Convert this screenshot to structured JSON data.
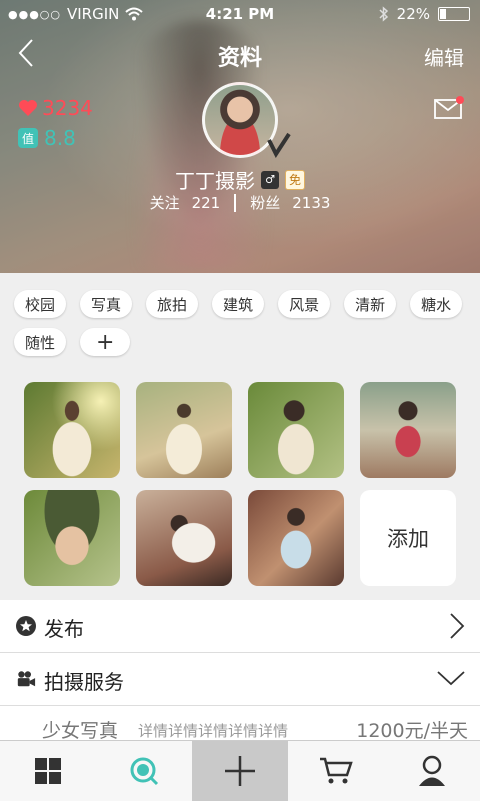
{
  "status_bar": {
    "carrier": "VIRGIN",
    "time": "4:21 PM",
    "battery": "22%",
    "battery_level": 0.22
  },
  "header": {
    "title": "资料",
    "edit_label": "编辑"
  },
  "profile": {
    "likes": "3234",
    "score_badge": "值",
    "score": "8.8",
    "name": "丁丁摄影",
    "free_badge": "免",
    "following_label": "关注",
    "following": "221",
    "fans_label": "粉丝",
    "fans": "2133"
  },
  "tags": [
    "校园",
    "写真",
    "旅拍",
    "建筑",
    "风景",
    "清新",
    "糖水",
    "随性"
  ],
  "add_tag_label": "+",
  "photos_add_label": "添加",
  "sections": {
    "publish": "发布",
    "service": "拍摄服务"
  },
  "service_item": {
    "name": "少女写真",
    "desc": "详情详情详情详情详情",
    "price": "1200元/半天"
  },
  "tabbar": {
    "active_index": 2
  },
  "colors": {
    "like": "#ff4b57",
    "accent": "#41c2b6"
  }
}
